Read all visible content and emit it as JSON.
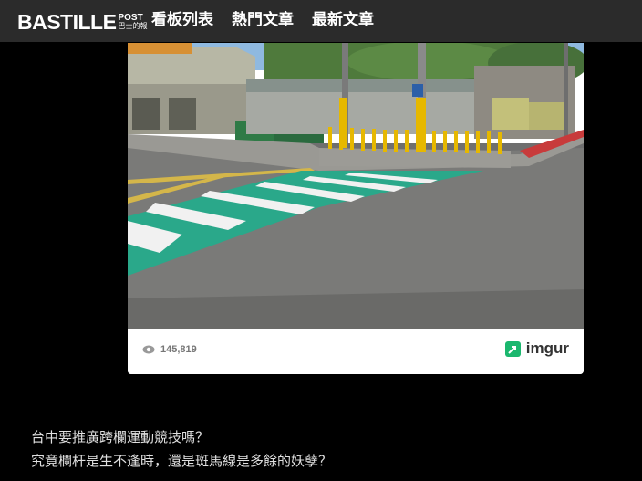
{
  "header": {
    "logo_main": "BASTILLE",
    "logo_post": "POST",
    "logo_sub": "巴士的報",
    "nav": [
      {
        "label": "看板列表"
      },
      {
        "label": "熱門文章"
      },
      {
        "label": "最新文章"
      }
    ]
  },
  "embed": {
    "views": "145,819",
    "brand": "imgur",
    "image_alt": "斑馬線 crosswalk photo"
  },
  "article": {
    "lines": [
      "台中要推廣跨欄運動競技嗎？",
      "究竟欄杆是生不逢時，還是斑馬線是多餘的妖孽？"
    ]
  },
  "colors": {
    "topbar_bg": "#2b2b2b",
    "page_bg": "#000000",
    "crosswalk_green": "#2aa88a",
    "bollard_yellow": "#e6b800",
    "imgur_green": "#1bb76e"
  }
}
